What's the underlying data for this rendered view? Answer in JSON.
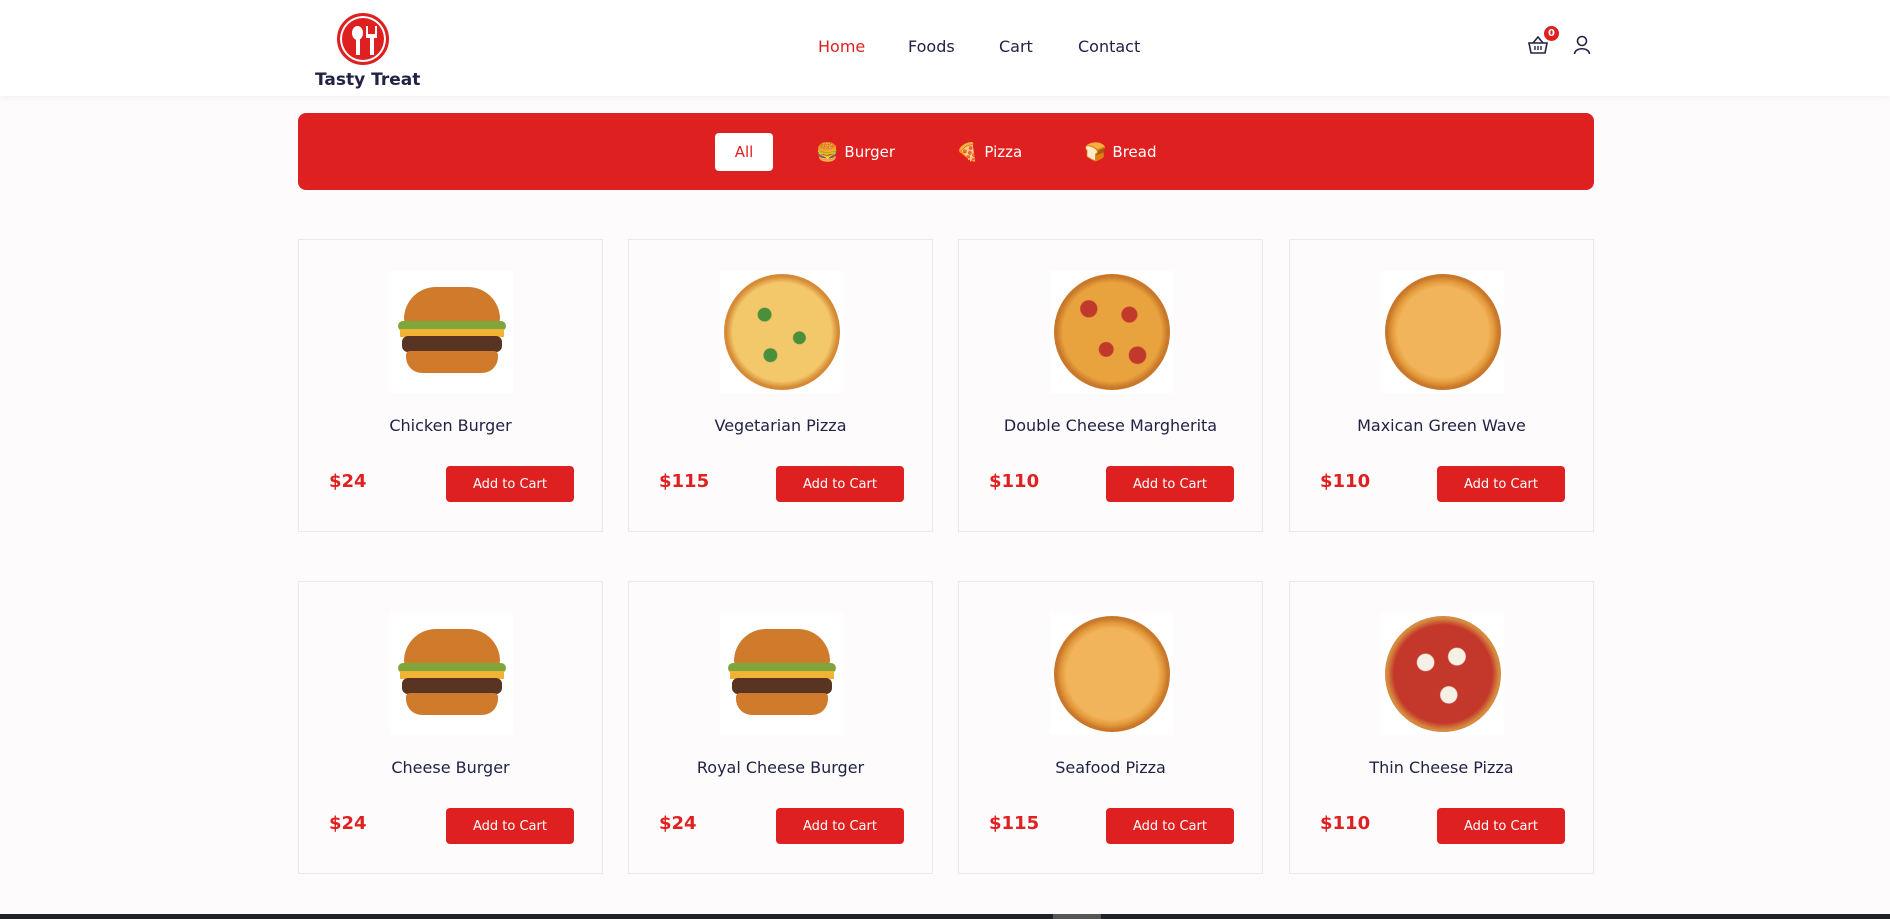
{
  "brand": {
    "name": "Tasty Treat"
  },
  "nav": {
    "items": [
      {
        "label": "Home",
        "active": true
      },
      {
        "label": "Foods"
      },
      {
        "label": "Cart"
      },
      {
        "label": "Contact"
      }
    ]
  },
  "header": {
    "cart_count": "0",
    "cart_icon": "shopping-basket-icon",
    "user_icon": "user-icon"
  },
  "filters": {
    "items": [
      {
        "label": "All",
        "active": true
      },
      {
        "label": "Burger",
        "icon": "🍔"
      },
      {
        "label": "Pizza",
        "icon": "🍕"
      },
      {
        "label": "Bread",
        "icon": "🍞"
      }
    ]
  },
  "colors": {
    "accent": "#df2020",
    "text": "#212245",
    "background": "#fdfbfb"
  },
  "products": [
    {
      "title": "Chicken Burger",
      "price": "$24",
      "type": "burger",
      "button": "Add to Cart"
    },
    {
      "title": "Vegetarian Pizza",
      "price": "$115",
      "type": "pizza-veg",
      "button": "Add to Cart"
    },
    {
      "title": "Double Cheese Margherita",
      "price": "$110",
      "type": "pizza-pep",
      "button": "Add to Cart"
    },
    {
      "title": "Maxican Green Wave",
      "price": "$110",
      "type": "pizza",
      "button": "Add to Cart"
    },
    {
      "title": "Cheese Burger",
      "price": "$24",
      "type": "burger",
      "button": "Add to Cart"
    },
    {
      "title": "Royal Cheese Burger",
      "price": "$24",
      "type": "burger",
      "button": "Add to Cart"
    },
    {
      "title": "Seafood Pizza",
      "price": "$115",
      "type": "pizza",
      "button": "Add to Cart"
    },
    {
      "title": "Thin Cheese Pizza",
      "price": "$110",
      "type": "pizza-thin",
      "button": "Add to Cart"
    }
  ]
}
